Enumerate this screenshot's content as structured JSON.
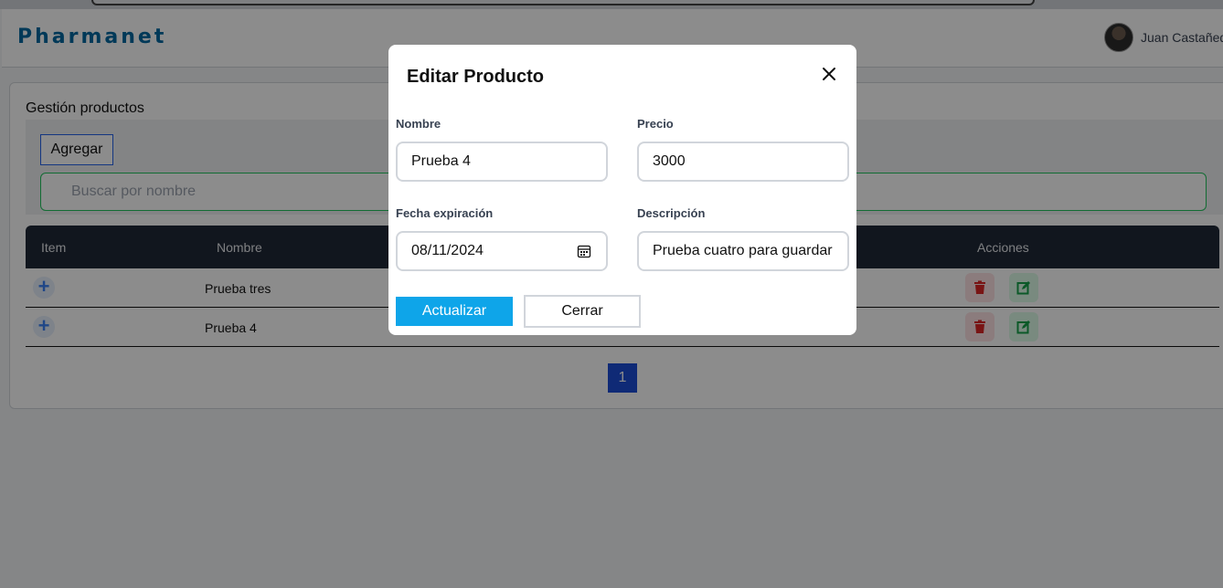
{
  "app": {
    "brand": "Pharmanet",
    "user_name": "Juan Castañeda"
  },
  "page": {
    "title": "Gestión productos",
    "add_label": "Agregar",
    "search_placeholder": "Buscar por nombre"
  },
  "table": {
    "headers": {
      "item": "Item",
      "nombre": "Nombre",
      "acciones": "Acciones"
    },
    "rows": [
      {
        "name": "Prueba tres"
      },
      {
        "name": "Prueba 4"
      }
    ]
  },
  "pagination": {
    "current": "1"
  },
  "modal": {
    "title": "Editar Producto",
    "fields": {
      "nombre": {
        "label": "Nombre",
        "value": "Prueba 4"
      },
      "precio": {
        "label": "Precio",
        "value": "3000"
      },
      "fecha": {
        "label": "Fecha expiración",
        "value": "08/11/2024"
      },
      "descripcion": {
        "label": "Descripción",
        "value": "Prueba cuatro para guardar"
      }
    },
    "update_label": "Actualizar",
    "close_label": "Cerrar"
  },
  "colors": {
    "brand": "#0369a1",
    "accent": "#0ea5e9",
    "table_header": "#1f2937",
    "delete": "#dc2626",
    "edit": "#16a34a"
  }
}
